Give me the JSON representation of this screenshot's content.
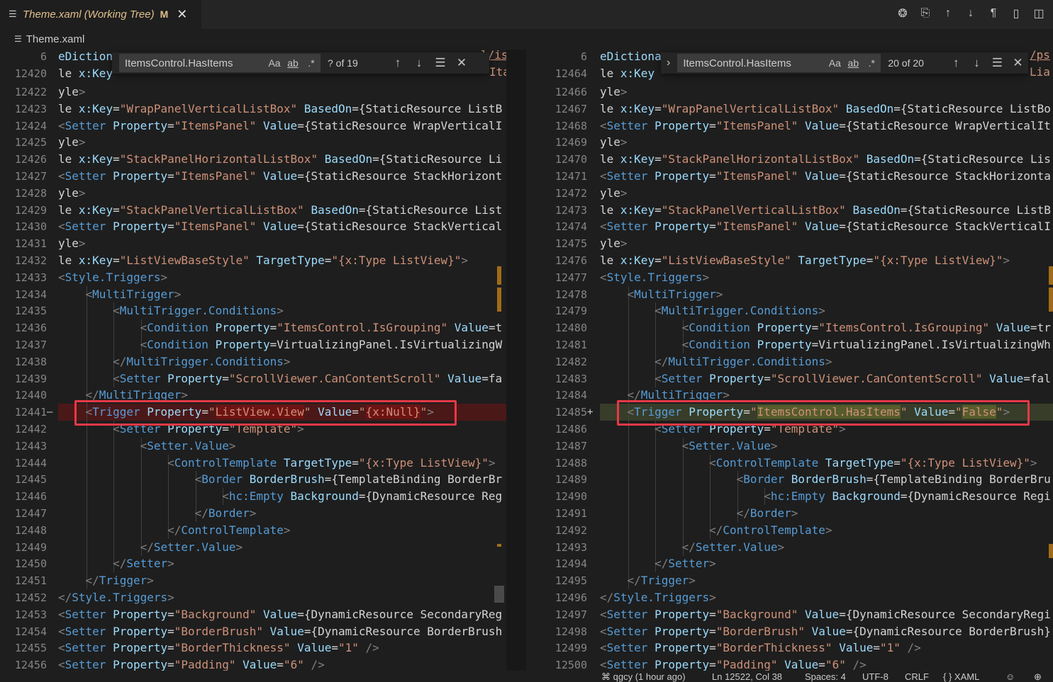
{
  "tab": {
    "title": "Theme.xaml (Working Tree)",
    "modified": "M",
    "close_glyph": "✕",
    "menu_icon": "menu-icon"
  },
  "editor_actions": [
    {
      "name": "openai-icon",
      "glyph": "❂"
    },
    {
      "name": "open-changes-icon",
      "glyph": "⎘"
    },
    {
      "name": "previous-change-icon",
      "glyph": "↑"
    },
    {
      "name": "next-change-icon",
      "glyph": "↓"
    },
    {
      "name": "show-whitespace-icon",
      "glyph": "¶"
    },
    {
      "name": "open-book-icon",
      "glyph": "▯"
    },
    {
      "name": "split-editor-icon",
      "glyph": "◫"
    }
  ],
  "breadcrumb": {
    "file": "Theme.xaml"
  },
  "find_left": {
    "query": "ItemsControl.HasItems",
    "match_case": "Aa",
    "whole_word": "ab",
    "regex": ".*",
    "count": "? of 19"
  },
  "find_right": {
    "query": "ItemsControl.HasItems",
    "match_case": "Aa",
    "whole_word": "ab",
    "regex": ".*",
    "count": "20 of 20"
  },
  "left_pane": {
    "first_line": {
      "num": "6",
      "text": "eDiction"
    },
    "second_line": {
      "num": "12420",
      "text": "le x:Key"
    },
    "lines": [
      {
        "num": "12422",
        "text": "yle>"
      },
      {
        "num": "12423",
        "text": "le x:Key=\"WrapPanelVerticalListBox\" BasedOn=\"{StaticResource ListB"
      },
      {
        "num": "12424",
        "text": "<Setter Property=\"ItemsPanel\" Value=\"{StaticResource WrapVerticalI"
      },
      {
        "num": "12425",
        "text": "yle>"
      },
      {
        "num": "12426",
        "text": "le x:Key=\"StackPanelHorizontalListBox\" BasedOn=\"{StaticResource Li"
      },
      {
        "num": "12427",
        "text": "<Setter Property=\"ItemsPanel\" Value=\"{StaticResource StackHorizont"
      },
      {
        "num": "12428",
        "text": "yle>"
      },
      {
        "num": "12429",
        "text": "le x:Key=\"StackPanelVerticalListBox\" BasedOn=\"{StaticResource List"
      },
      {
        "num": "12430",
        "text": "<Setter Property=\"ItemsPanel\" Value=\"{StaticResource StackVertical"
      },
      {
        "num": "12431",
        "text": "yle>"
      },
      {
        "num": "12432",
        "text": "le x:Key=\"ListViewBaseStyle\" TargetType=\"{x:Type ListView}\">"
      },
      {
        "num": "12433",
        "text": "<Style.Triggers>"
      },
      {
        "num": "12434",
        "text": "    <MultiTrigger>"
      },
      {
        "num": "12435",
        "text": "        <MultiTrigger.Conditions>"
      },
      {
        "num": "12436",
        "text": "            <Condition Property=\"ItemsControl.IsGrouping\" Value=\"t"
      },
      {
        "num": "12437",
        "text": "            <Condition Property=\"VirtualizingPanel.IsVirtualizingW"
      },
      {
        "num": "12438",
        "text": "        </MultiTrigger.Conditions>"
      },
      {
        "num": "12439",
        "text": "        <Setter Property=\"ScrollViewer.CanContentScroll\" Value=\"fa"
      },
      {
        "num": "12440",
        "text": "    </MultiTrigger>"
      },
      {
        "num": "12441",
        "text": "    <Trigger Property=\"ListView.View\" Value=\"{x:Null}\">",
        "diff": "removed",
        "mark": "—"
      },
      {
        "num": "12442",
        "text": "        <Setter Property=\"Template\">"
      },
      {
        "num": "12443",
        "text": "            <Setter.Value>"
      },
      {
        "num": "12444",
        "text": "                <ControlTemplate TargetType=\"{x:Type ListView}\">"
      },
      {
        "num": "12445",
        "text": "                    <Border BorderBrush=\"{TemplateBinding BorderBr"
      },
      {
        "num": "12446",
        "text": "                        <hc:Empty Background=\"{DynamicResource Reg"
      },
      {
        "num": "12447",
        "text": "                    </Border>"
      },
      {
        "num": "12448",
        "text": "                </ControlTemplate>"
      },
      {
        "num": "12449",
        "text": "            </Setter.Value>"
      },
      {
        "num": "12450",
        "text": "        </Setter>"
      },
      {
        "num": "12451",
        "text": "    </Trigger>"
      },
      {
        "num": "12452",
        "text": "</Style.Triggers>"
      },
      {
        "num": "12453",
        "text": "<Setter Property=\"Background\" Value=\"{DynamicResource SecondaryReg"
      },
      {
        "num": "12454",
        "text": "<Setter Property=\"BorderBrush\" Value=\"{DynamicResource BorderBrush"
      },
      {
        "num": "12455",
        "text": "<Setter Property=\"BorderThickness\" Value=\"1\" />"
      },
      {
        "num": "12456",
        "text": "<Setter Property=\"Padding\" Value=\"6\" />"
      }
    ],
    "top_right_fragments": {
      "a": "l/is",
      "b": "Ita"
    }
  },
  "right_pane": {
    "first_line": {
      "num": "6",
      "text": "eDictiona"
    },
    "second_line": {
      "num": "12464",
      "text": "le x:Key"
    },
    "lines": [
      {
        "num": "12466",
        "text": "yle>"
      },
      {
        "num": "12467",
        "text": "le x:Key=\"WrapPanelVerticalListBox\" BasedOn=\"{StaticResource ListBo"
      },
      {
        "num": "12468",
        "text": "<Setter Property=\"ItemsPanel\" Value=\"{StaticResource WrapVerticalIt"
      },
      {
        "num": "12469",
        "text": "yle>"
      },
      {
        "num": "12470",
        "text": "le x:Key=\"StackPanelHorizontalListBox\" BasedOn=\"{StaticResource Lis"
      },
      {
        "num": "12471",
        "text": "<Setter Property=\"ItemsPanel\" Value=\"{StaticResource StackHorizonta"
      },
      {
        "num": "12472",
        "text": "yle>"
      },
      {
        "num": "12473",
        "text": "le x:Key=\"StackPanelVerticalListBox\" BasedOn=\"{StaticResource ListB"
      },
      {
        "num": "12474",
        "text": "<Setter Property=\"ItemsPanel\" Value=\"{StaticResource StackVerticalI"
      },
      {
        "num": "12475",
        "text": "yle>"
      },
      {
        "num": "12476",
        "text": "le x:Key=\"ListViewBaseStyle\" TargetType=\"{x:Type ListView}\">"
      },
      {
        "num": "12477",
        "text": "<Style.Triggers>"
      },
      {
        "num": "12478",
        "text": "    <MultiTrigger>"
      },
      {
        "num": "12479",
        "text": "        <MultiTrigger.Conditions>"
      },
      {
        "num": "12480",
        "text": "            <Condition Property=\"ItemsControl.IsGrouping\" Value=\"tr"
      },
      {
        "num": "12481",
        "text": "            <Condition Property=\"VirtualizingPanel.IsVirtualizingWh"
      },
      {
        "num": "12482",
        "text": "        </MultiTrigger.Conditions>"
      },
      {
        "num": "12483",
        "text": "        <Setter Property=\"ScrollViewer.CanContentScroll\" Value=\"fal"
      },
      {
        "num": "12484",
        "text": "    </MultiTrigger>"
      },
      {
        "num": "12485",
        "text": "    <Trigger Property=\"ItemsControl.HasItems\" Value=\"False\">",
        "diff": "added",
        "mark": "+"
      },
      {
        "num": "12486",
        "text": "        <Setter Property=\"Template\">"
      },
      {
        "num": "12487",
        "text": "            <Setter.Value>"
      },
      {
        "num": "12488",
        "text": "                <ControlTemplate TargetType=\"{x:Type ListView}\">"
      },
      {
        "num": "12489",
        "text": "                    <Border BorderBrush=\"{TemplateBinding BorderBru"
      },
      {
        "num": "12490",
        "text": "                        <hc:Empty Background=\"{DynamicResource Regi"
      },
      {
        "num": "12491",
        "text": "                    </Border>"
      },
      {
        "num": "12492",
        "text": "                </ControlTemplate>"
      },
      {
        "num": "12493",
        "text": "            </Setter.Value>"
      },
      {
        "num": "12494",
        "text": "        </Setter>"
      },
      {
        "num": "12495",
        "text": "    </Trigger>"
      },
      {
        "num": "12496",
        "text": "</Style.Triggers>"
      },
      {
        "num": "12497",
        "text": "<Setter Property=\"Background\" Value=\"{DynamicResource SecondaryRegi"
      },
      {
        "num": "12498",
        "text": "<Setter Property=\"BorderBrush\" Value=\"{DynamicResource BorderBrush}"
      },
      {
        "num": "12499",
        "text": "<Setter Property=\"BorderThickness\" Value=\"1\" />"
      },
      {
        "num": "12500",
        "text": "<Setter Property=\"Padding\" Value=\"6\" />"
      }
    ],
    "top_right_fragments": {
      "a": "/ps",
      "b": "Lia"
    }
  },
  "statusbar": {
    "blame": "qgcy (1 hour ago)",
    "position": "Ln 12522, Col 38",
    "spaces": "Spaces: 4",
    "encoding": "UTF-8",
    "eol": "CRLF",
    "language": "XAML"
  },
  "colors": {
    "removed_line": "#4b1818",
    "added_line": "#373d29",
    "annotation": "#e63946"
  }
}
